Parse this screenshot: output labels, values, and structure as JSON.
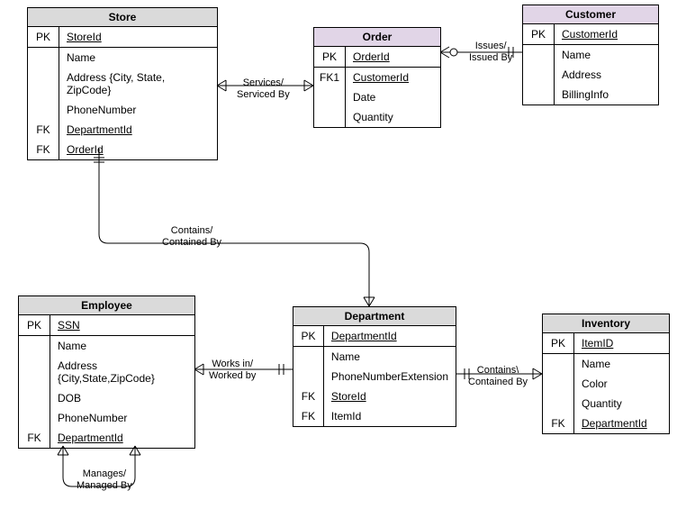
{
  "entities": {
    "store": {
      "title": "Store",
      "rows": [
        {
          "key": "PK",
          "attr": "StoreId",
          "u": true,
          "sep": false
        },
        {
          "key": "",
          "attr": "Name",
          "u": false,
          "sep": true
        },
        {
          "key": "",
          "attr": "Address {City, State, ZipCode}",
          "u": false,
          "sep": false
        },
        {
          "key": "",
          "attr": "PhoneNumber",
          "u": false,
          "sep": false
        },
        {
          "key": "FK",
          "attr": "DepartmentId",
          "u": true,
          "sep": false
        },
        {
          "key": "FK",
          "attr": "OrderId",
          "u": true,
          "sep": false
        }
      ]
    },
    "order": {
      "title": "Order",
      "rows": [
        {
          "key": "PK",
          "attr": "OrderId",
          "u": true,
          "sep": false
        },
        {
          "key": "FK1",
          "attr": "CustomerId",
          "u": true,
          "sep": true
        },
        {
          "key": "",
          "attr": "Date",
          "u": false,
          "sep": false
        },
        {
          "key": "",
          "attr": "Quantity",
          "u": false,
          "sep": false
        }
      ]
    },
    "customer": {
      "title": "Customer",
      "rows": [
        {
          "key": "PK",
          "attr": "CustomerId",
          "u": true,
          "sep": false
        },
        {
          "key": "",
          "attr": "Name",
          "u": false,
          "sep": true
        },
        {
          "key": "",
          "attr": "Address",
          "u": false,
          "sep": false
        },
        {
          "key": "",
          "attr": "BillingInfo",
          "u": false,
          "sep": false
        }
      ]
    },
    "employee": {
      "title": "Employee",
      "rows": [
        {
          "key": "PK",
          "attr": "SSN",
          "u": true,
          "sep": false
        },
        {
          "key": "",
          "attr": "Name",
          "u": false,
          "sep": true
        },
        {
          "key": "",
          "attr": "Address {City,State,ZipCode}",
          "u": false,
          "sep": false
        },
        {
          "key": "",
          "attr": "DOB",
          "u": false,
          "sep": false
        },
        {
          "key": "",
          "attr": "PhoneNumber",
          "u": false,
          "sep": false
        },
        {
          "key": "FK",
          "attr": "DepartmentId",
          "u": true,
          "sep": false
        }
      ]
    },
    "department": {
      "title": "Department",
      "rows": [
        {
          "key": "PK",
          "attr": "DepartmentId",
          "u": true,
          "sep": false
        },
        {
          "key": "",
          "attr": "Name",
          "u": false,
          "sep": true
        },
        {
          "key": "",
          "attr": "PhoneNumberExtension",
          "u": false,
          "sep": false
        },
        {
          "key": "FK",
          "attr": "StoreId",
          "u": true,
          "sep": false
        },
        {
          "key": "FK",
          "attr": "ItemId",
          "u": false,
          "sep": false
        }
      ]
    },
    "inventory": {
      "title": "Inventory",
      "rows": [
        {
          "key": "PK",
          "attr": "ItemID",
          "u": true,
          "sep": false
        },
        {
          "key": "",
          "attr": "Name",
          "u": false,
          "sep": true
        },
        {
          "key": "",
          "attr": "Color",
          "u": false,
          "sep": false
        },
        {
          "key": "",
          "attr": "Quantity",
          "u": false,
          "sep": false
        },
        {
          "key": "FK",
          "attr": "DepartmentId",
          "u": true,
          "sep": false
        }
      ]
    }
  },
  "relationships": {
    "store_order": "Services/\nServiced By",
    "order_customer": "Issues/\nIssued By",
    "store_department": "Contains/\nContained By",
    "employee_department": "Works in/\nWorked by",
    "department_inventory": "Contains\\\nContained By",
    "employee_self": "Manages/\nManaged By"
  }
}
